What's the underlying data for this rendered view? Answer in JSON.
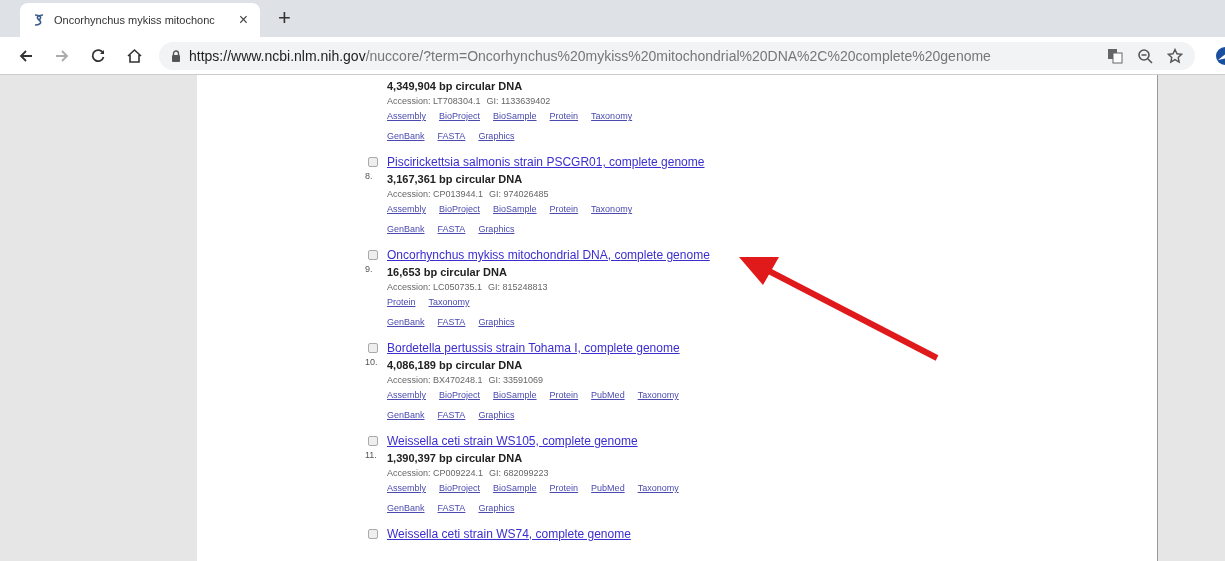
{
  "browser": {
    "tab": {
      "title": "Oncorhynchus mykiss mitochonc",
      "close": "×"
    },
    "new_tab": "+",
    "url": {
      "host": "https://www.ncbi.nlm.nih.gov",
      "path": "/nuccore/?term=Oncorhynchus%20mykiss%20mitochondrial%20DNA%2C%20complete%20genome"
    }
  },
  "results": [
    {
      "size": "4,349,904 bp circular DNA",
      "accession": "Accession: LT708304.1",
      "gi": "GI: 1133639402",
      "link_rows": [
        [
          "Assembly",
          "BioProject",
          "BioSample",
          "Protein",
          "Taxonomy"
        ],
        [
          "GenBank",
          "FASTA",
          "Graphics"
        ]
      ]
    },
    {
      "checked": false,
      "number": "8.",
      "title": "Piscirickettsia salmonis strain PSCGR01, complete genome",
      "size": "3,167,361 bp circular DNA",
      "accession": "Accession: CP013944.1",
      "gi": "GI: 974026485",
      "link_rows": [
        [
          "Assembly",
          "BioProject",
          "BioSample",
          "Protein",
          "Taxonomy"
        ],
        [
          "GenBank",
          "FASTA",
          "Graphics"
        ]
      ]
    },
    {
      "checked": false,
      "number": "9.",
      "title": "Oncorhynchus mykiss mitochondrial DNA, complete genome",
      "size": "16,653 bp circular DNA",
      "accession": "Accession: LC050735.1",
      "gi": "GI: 815248813",
      "link_rows": [
        [
          "Protein",
          "Taxonomy"
        ],
        [
          "GenBank",
          "FASTA",
          "Graphics"
        ]
      ]
    },
    {
      "checked": false,
      "number": "10.",
      "title": "Bordetella pertussis strain Tohama I, complete genome",
      "size": "4,086,189 bp circular DNA",
      "accession": "Accession: BX470248.1",
      "gi": "GI: 33591069",
      "link_rows": [
        [
          "Assembly",
          "BioProject",
          "BioSample",
          "Protein",
          "PubMed",
          "Taxonomy"
        ],
        [
          "GenBank",
          "FASTA",
          "Graphics"
        ]
      ]
    },
    {
      "checked": false,
      "number": "11.",
      "title": "Weissella ceti strain WS105, complete genome",
      "size": "1,390,397 bp circular DNA",
      "accession": "Accession: CP009224.1",
      "gi": "GI: 682099223",
      "link_rows": [
        [
          "Assembly",
          "BioProject",
          "BioSample",
          "Protein",
          "PubMed",
          "Taxonomy"
        ],
        [
          "GenBank",
          "FASTA",
          "Graphics"
        ]
      ]
    },
    {
      "checked": false,
      "title": "Weissella ceti strain WS74, complete genome"
    }
  ]
}
